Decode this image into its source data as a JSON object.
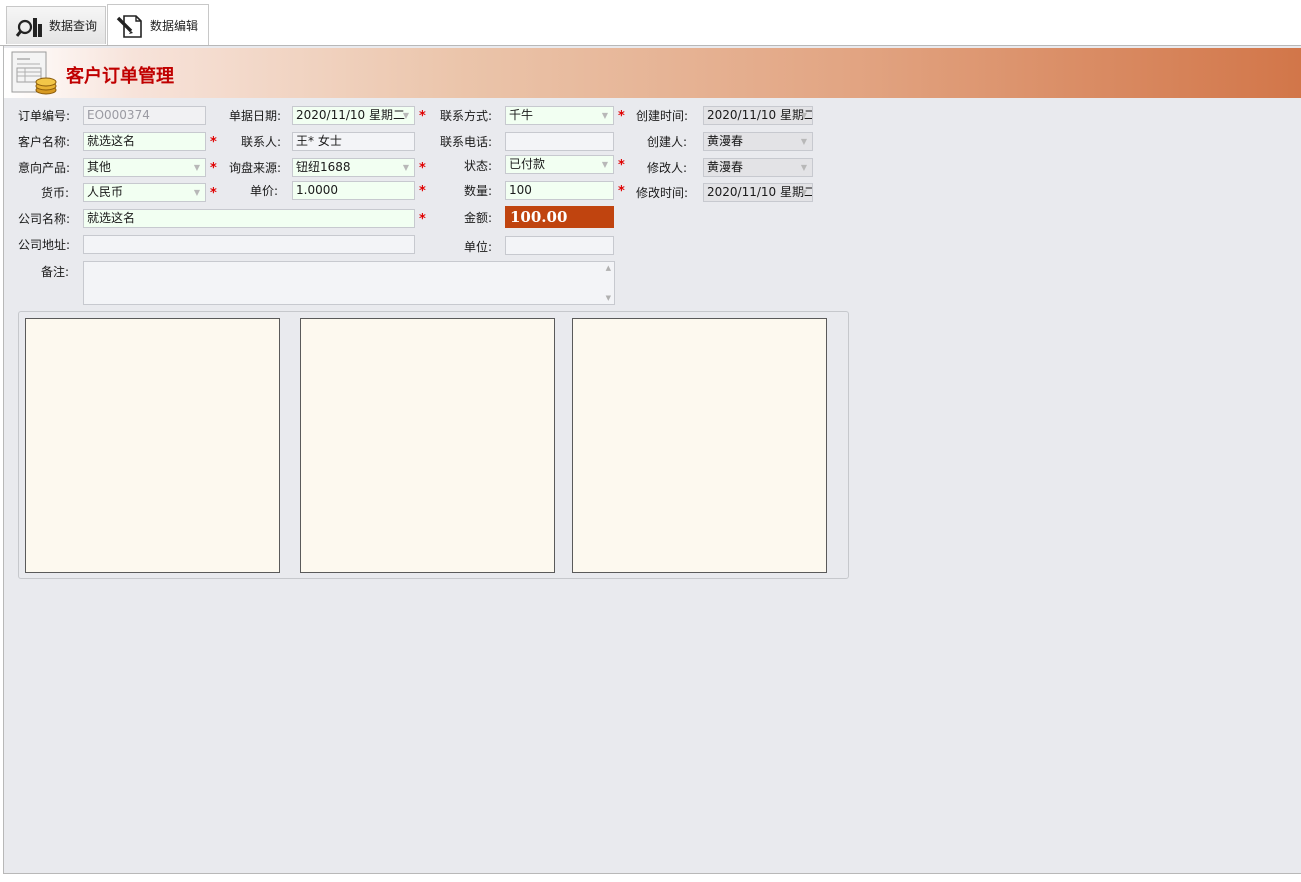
{
  "tabs": [
    {
      "label": "数据查询",
      "icon": "search-chart-icon"
    },
    {
      "label": "数据编辑",
      "icon": "edit-document-icon"
    }
  ],
  "header": {
    "title": "客户订单管理",
    "icon": "document-coins-icon"
  },
  "colors": {
    "accent": "#d27649",
    "title": "#c00000",
    "amount_bg": "#c0440f",
    "required_star": "#e00000",
    "required_bg": "#f2fff2"
  },
  "form": {
    "order_no": {
      "label": "订单编号:",
      "value": "EO000374"
    },
    "order_date": {
      "label": "单据日期:",
      "value": "2020/11/10 星期二"
    },
    "contact_method": {
      "label": "联系方式:",
      "value": "千牛"
    },
    "created_time": {
      "label": "创建时间:",
      "value": "2020/11/10 星期二"
    },
    "customer_name": {
      "label": "客户名称:",
      "value": "就选这名"
    },
    "contact_person": {
      "label": "联系人:",
      "value": "王* 女士"
    },
    "contact_phone": {
      "label": "联系电话:",
      "value": ""
    },
    "creator": {
      "label": "创建人:",
      "value": "黄漫春"
    },
    "product": {
      "label": "意向产品:",
      "value": "其他"
    },
    "inquiry_source": {
      "label": "询盘来源:",
      "value": "钮纽1688"
    },
    "status": {
      "label": "状态:",
      "value": "已付款"
    },
    "modifier": {
      "label": "修改人:",
      "value": "黄漫春"
    },
    "currency": {
      "label": "货币:",
      "value": "人民币"
    },
    "unit_price": {
      "label": "单价:",
      "value": "1.0000"
    },
    "quantity": {
      "label": "数量:",
      "value": "100"
    },
    "modified_time": {
      "label": "修改时间:",
      "value": "2020/11/10 星期二"
    },
    "company_name": {
      "label": "公司名称:",
      "value": "就选这名"
    },
    "amount": {
      "label": "金额:",
      "value": "100.00"
    },
    "company_address": {
      "label": "公司地址:",
      "value": ""
    },
    "unit": {
      "label": "单位:",
      "value": ""
    },
    "remarks": {
      "label": "备注:",
      "value": ""
    },
    "required_mark": "*"
  }
}
